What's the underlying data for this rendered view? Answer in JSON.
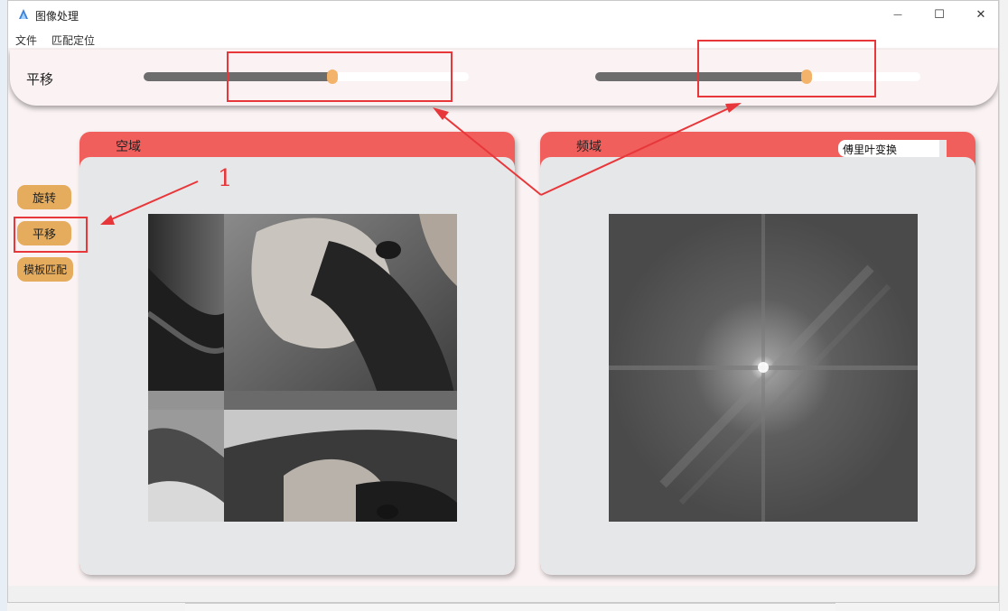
{
  "window": {
    "title": "图像处理",
    "controls": {
      "minimize": "—",
      "maximize": "☐",
      "close": "✕"
    }
  },
  "menu": [
    "文件",
    "匹配定位"
  ],
  "slider_panel": {
    "label": "平移",
    "sliders": [
      {
        "name": "horizontal-shift",
        "value_fraction": 0.58
      },
      {
        "name": "vertical-shift",
        "value_fraction": 0.65
      }
    ]
  },
  "side_buttons": [
    "旋转",
    "平移",
    "模板匹配"
  ],
  "panels": {
    "spatial": {
      "title": "空域"
    },
    "frequency": {
      "title": "频域",
      "mode_select": "傅里叶变换"
    }
  },
  "annotation": {
    "number": "1"
  },
  "colors": {
    "panel_header": "#f05f5c",
    "button": "#e5ac5d",
    "slider_thumb": "#f4b36b",
    "slider_fill": "#6d6d6d",
    "annotation": "#e8373a"
  }
}
